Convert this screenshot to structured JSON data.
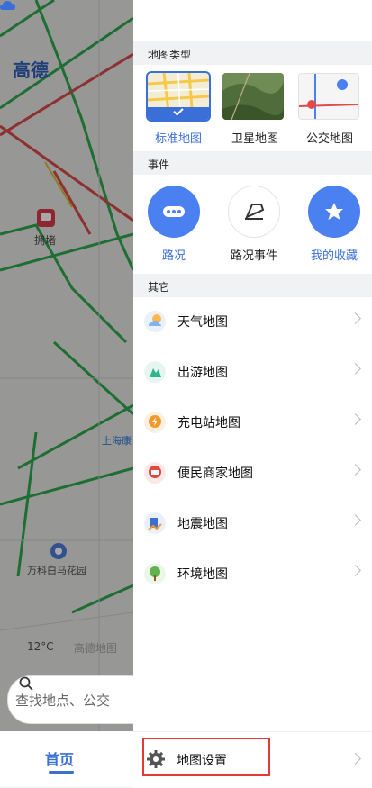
{
  "map": {
    "brand": "高德",
    "jam_label": "拥堵",
    "poi1": "上海康",
    "poi2": "万科白马花园",
    "temperature": "12°C",
    "amap_logo": "高德地图",
    "search_placeholder": "查找地点、公交",
    "tab_home": "首页"
  },
  "panel": {
    "map_type_header": "地图类型",
    "map_types": [
      {
        "label": "标准地图",
        "selected": true
      },
      {
        "label": "卫星地图",
        "selected": false
      },
      {
        "label": "公交地图",
        "selected": false
      }
    ],
    "events_header": "事件",
    "events": [
      {
        "label": "路况",
        "icon": "traffic-icon"
      },
      {
        "label": "路况事件",
        "icon": "road-event-icon"
      },
      {
        "label": "我的收藏",
        "icon": "star-icon"
      }
    ],
    "other_header": "其它",
    "others": [
      {
        "label": "天气地图",
        "icon": "weather-icon",
        "color": "#ffb74d"
      },
      {
        "label": "出游地图",
        "icon": "travel-icon",
        "color": "#2eb58f"
      },
      {
        "label": "充电站地图",
        "icon": "charging-icon",
        "color": "#f29b2a"
      },
      {
        "label": "便民商家地图",
        "icon": "merchant-icon",
        "color": "#e0483d"
      },
      {
        "label": "地震地图",
        "icon": "earthquake-icon",
        "color": "#3c6fd1"
      },
      {
        "label": "环境地图",
        "icon": "environment-icon",
        "color": "#61b34f"
      }
    ],
    "settings_label": "地图设置"
  },
  "colors": {
    "accent": "#3a6fd8",
    "highlight_box": "#e53935"
  }
}
